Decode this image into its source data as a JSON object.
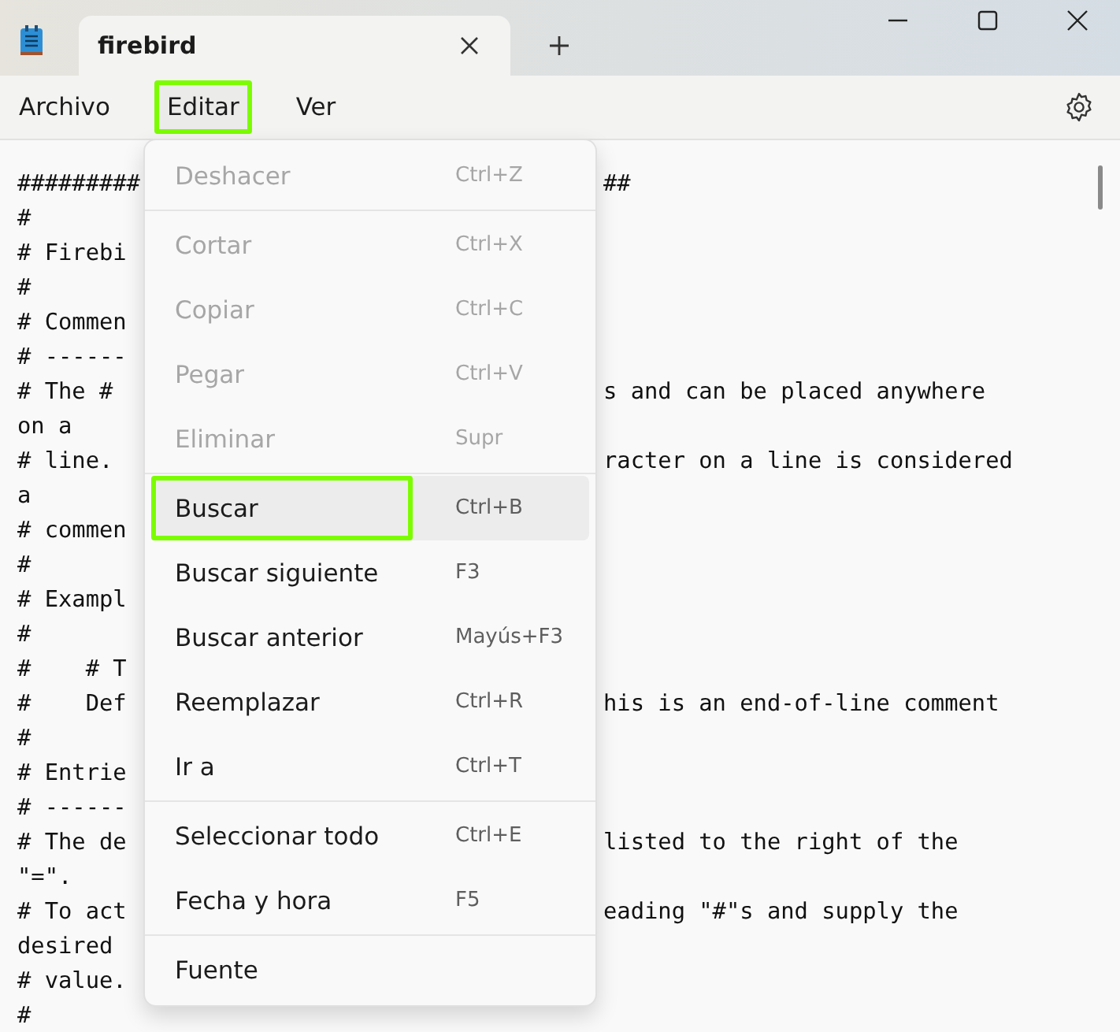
{
  "tab": {
    "title": "firebird",
    "selected": true
  },
  "menubar": [
    {
      "label": "Archivo",
      "highlighted": false
    },
    {
      "label": "Editar",
      "highlighted": true
    },
    {
      "label": "Ver",
      "highlighted": false
    }
  ],
  "editor_lines": [
    {
      "left": "#########",
      "right": "##"
    },
    {
      "left": "#"
    },
    {
      "left": "# Firebi"
    },
    {
      "left": "#"
    },
    {
      "left": "# Commen"
    },
    {
      "left": "# ------"
    },
    {
      "left": "# The #",
      "right": "s and can be placed anywhere"
    },
    {
      "left": "on a"
    },
    {
      "left": "# line.",
      "right": "racter on a line is considered"
    },
    {
      "left": "a"
    },
    {
      "left": "# commen"
    },
    {
      "left": "#"
    },
    {
      "left": "# Exampl"
    },
    {
      "left": "#"
    },
    {
      "left": "#    # T"
    },
    {
      "left": "#    Def",
      "right": "his is an end-of-line comment"
    },
    {
      "left": "#"
    },
    {
      "left": "# Entrie"
    },
    {
      "left": "# ------"
    },
    {
      "left": "# The de",
      "right": "listed to the right of the"
    },
    {
      "left": "\"=\"."
    },
    {
      "left": "# To act",
      "right": "eading \"#\"s and supply the"
    },
    {
      "left": "desired"
    },
    {
      "left": "# value."
    },
    {
      "left": "#"
    }
  ],
  "edit_menu": [
    [
      {
        "label": "Deshacer",
        "shortcut": "Ctrl+Z",
        "disabled": true,
        "selected": false,
        "highlighted": false
      }
    ],
    [
      {
        "label": "Cortar",
        "shortcut": "Ctrl+X",
        "disabled": true,
        "selected": false,
        "highlighted": false
      },
      {
        "label": "Copiar",
        "shortcut": "Ctrl+C",
        "disabled": true,
        "selected": false,
        "highlighted": false
      },
      {
        "label": "Pegar",
        "shortcut": "Ctrl+V",
        "disabled": true,
        "selected": false,
        "highlighted": false
      },
      {
        "label": "Eliminar",
        "shortcut": "Supr",
        "disabled": true,
        "selected": false,
        "highlighted": false
      }
    ],
    [
      {
        "label": "Buscar",
        "shortcut": "Ctrl+B",
        "disabled": false,
        "selected": true,
        "highlighted": true
      },
      {
        "label": "Buscar siguiente",
        "shortcut": "F3",
        "disabled": false,
        "selected": false,
        "highlighted": false
      },
      {
        "label": "Buscar anterior",
        "shortcut": "Mayús+F3",
        "disabled": false,
        "selected": false,
        "highlighted": false
      },
      {
        "label": "Reemplazar",
        "shortcut": "Ctrl+R",
        "disabled": false,
        "selected": false,
        "highlighted": false
      },
      {
        "label": "Ir a",
        "shortcut": "Ctrl+T",
        "disabled": false,
        "selected": false,
        "highlighted": false
      }
    ],
    [
      {
        "label": "Seleccionar todo",
        "shortcut": "Ctrl+E",
        "disabled": false,
        "selected": false,
        "highlighted": false
      },
      {
        "label": "Fecha y hora",
        "shortcut": "F5",
        "disabled": false,
        "selected": false,
        "highlighted": false
      }
    ],
    [
      {
        "label": "Fuente",
        "disabled": false,
        "selected": false,
        "highlighted": false
      }
    ]
  ]
}
